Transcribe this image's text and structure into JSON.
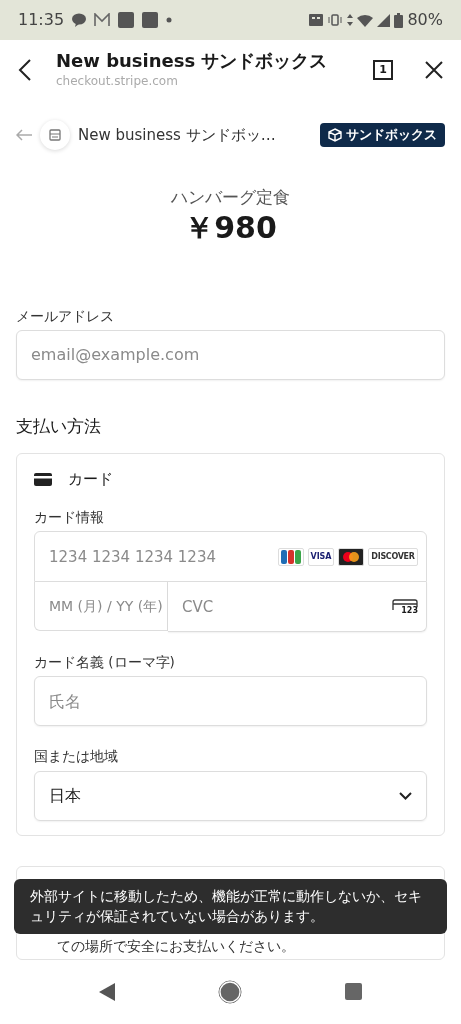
{
  "status_bar": {
    "time": "11:35",
    "battery": "80%"
  },
  "browser": {
    "title": "New business サンドボックス",
    "url": "checkout.stripe.com",
    "tab_count": "1"
  },
  "merchant": {
    "name": "New business サンドボッ…",
    "badge": "サンドボックス"
  },
  "product": {
    "name": "ハンバーグ定食",
    "price": "￥980"
  },
  "email": {
    "label": "メールアドレス",
    "placeholder": "email@example.com"
  },
  "payment": {
    "heading": "支払い方法",
    "method": "カード",
    "card_label": "カード情報",
    "card_number_placeholder": "1234 1234 1234 1234",
    "brands": [
      {
        "kind": "jcb"
      },
      {
        "kind": "visa",
        "text": "VISA"
      },
      {
        "kind": "mastercard"
      },
      {
        "kind": "discover",
        "text": "DISCOVER"
      }
    ],
    "expiry_placeholder": "MM (月) / YY (年)",
    "cvc_placeholder": "CVC",
    "cvc_icon_text": "123",
    "name_label": "カード名義 (ローマ字)",
    "name_placeholder": "氏名",
    "country_label": "国または地域",
    "country": "日本"
  },
  "save_info": {
    "visible_text": "ての場所で安全にお支払いください。"
  },
  "toast": "外部サイトに移動したため、機能が正常に動作しないか、セキュリティが保証されていない場合があります。"
}
